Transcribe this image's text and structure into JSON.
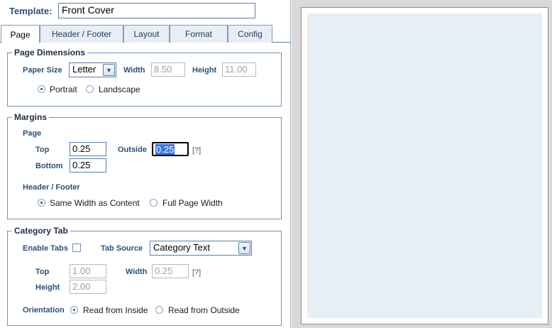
{
  "template": {
    "label": "Template:",
    "value": "Front Cover"
  },
  "tabs": [
    "Page",
    "Header / Footer",
    "Layout",
    "Format",
    "Config"
  ],
  "page_dimensions": {
    "title": "Page Dimensions",
    "paper_size_label": "Paper Size",
    "paper_size_value": "Letter",
    "width_label": "Width",
    "width_value": "8.50",
    "height_label": "Height",
    "height_value": "11.00",
    "orientation": {
      "portrait": "Portrait",
      "landscape": "Landscape",
      "selected": "Portrait"
    }
  },
  "margins": {
    "title": "Margins",
    "page_label": "Page",
    "top_label": "Top",
    "top_value": "0.25",
    "outside_label": "Outside",
    "outside_value": "0.25",
    "bottom_label": "Bottom",
    "bottom_value": "0.25",
    "help": "[?]",
    "header_footer_label": "Header / Footer",
    "same_width": "Same Width as Content",
    "full_width": "Full Page Width",
    "selected": "Same Width as Content"
  },
  "category_tab": {
    "title": "Category Tab",
    "enable_label": "Enable Tabs",
    "enabled": false,
    "source_label": "Tab Source",
    "source_value": "Category Text",
    "top_label": "Top",
    "top_value": "1.00",
    "width_label": "Width",
    "width_value": "0.25",
    "help": "[?]",
    "height_label": "Height",
    "height_value": "2.00",
    "orientation_label": "Orientation",
    "inside": "Read from Inside",
    "outside": "Read from Outside",
    "selected": "Read from Inside"
  },
  "colors": {
    "accent": "#2b5079",
    "border": "#6f93bb",
    "preview_bg": "#e6eef6",
    "pane_bg": "#d9d9d9"
  },
  "icons": {
    "dropdown": "chevron-down-icon",
    "help": "help-icon"
  }
}
